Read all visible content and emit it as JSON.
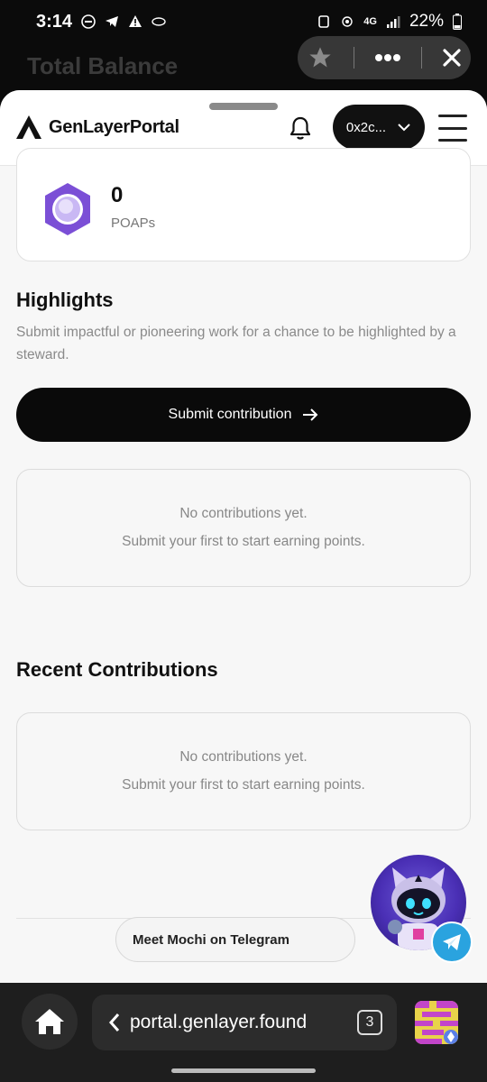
{
  "status_bar": {
    "time": "3:14",
    "network": "4G",
    "battery": "22%"
  },
  "background": {
    "title": "Total Balance"
  },
  "header": {
    "logo": "GenLayerPortal",
    "wallet_label": "0x2c..."
  },
  "poaps": {
    "count": "0",
    "label": "POAPs"
  },
  "highlights": {
    "title": "Highlights",
    "description": "Submit impactful or pioneering work for a chance to be highlighted by a steward.",
    "submit_label": "Submit contribution",
    "empty_line1": "No contributions yet.",
    "empty_line2": "Submit your first to start earning points."
  },
  "recent": {
    "title": "Recent Contributions",
    "empty_line1": "No contributions yet.",
    "empty_line2": "Submit your first to start earning points."
  },
  "telegram": {
    "label": "Meet Mochi on Telegram"
  },
  "browser": {
    "url": "portal.genlayer.found",
    "tab_count": "3"
  },
  "colors": {
    "accent": "#0a0a0a",
    "poap_purple": "#7b4fd6",
    "telegram_blue": "#2aa3df"
  }
}
